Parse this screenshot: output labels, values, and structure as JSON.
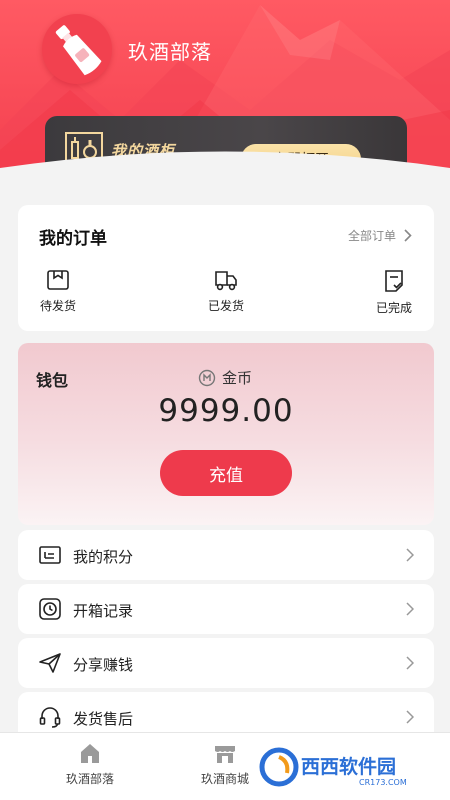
{
  "app": {
    "name": "玖酒部落"
  },
  "cabinet": {
    "title": "我的酒柜",
    "button": "立即打开"
  },
  "orders": {
    "title": "我的订单",
    "all_link": "全部订单",
    "items": [
      {
        "label": "待发货",
        "icon": "pending-shipment-icon"
      },
      {
        "label": "已发货",
        "icon": "truck-icon"
      },
      {
        "label": "已完成",
        "icon": "completed-icon"
      }
    ]
  },
  "wallet": {
    "title": "钱包",
    "currency_label": "金币",
    "balance": "9999.00",
    "recharge_button": "充值"
  },
  "menu": [
    {
      "label": "我的积分",
      "icon": "points-icon"
    },
    {
      "label": "开箱记录",
      "icon": "clock-icon"
    },
    {
      "label": "分享赚钱",
      "icon": "send-icon"
    },
    {
      "label": "发货售后",
      "icon": "headset-icon"
    }
  ],
  "tabbar": [
    {
      "label": "玖酒部落",
      "icon": "home-icon"
    },
    {
      "label": "玖酒商城",
      "icon": "shop-icon"
    }
  ],
  "watermark": {
    "brand": "西西软件园",
    "domain": "CR173.COM"
  },
  "colors": {
    "primary": "#ee3a4c",
    "gold": "#f3d79e",
    "cabinet_bg": "#3f3c3f"
  }
}
